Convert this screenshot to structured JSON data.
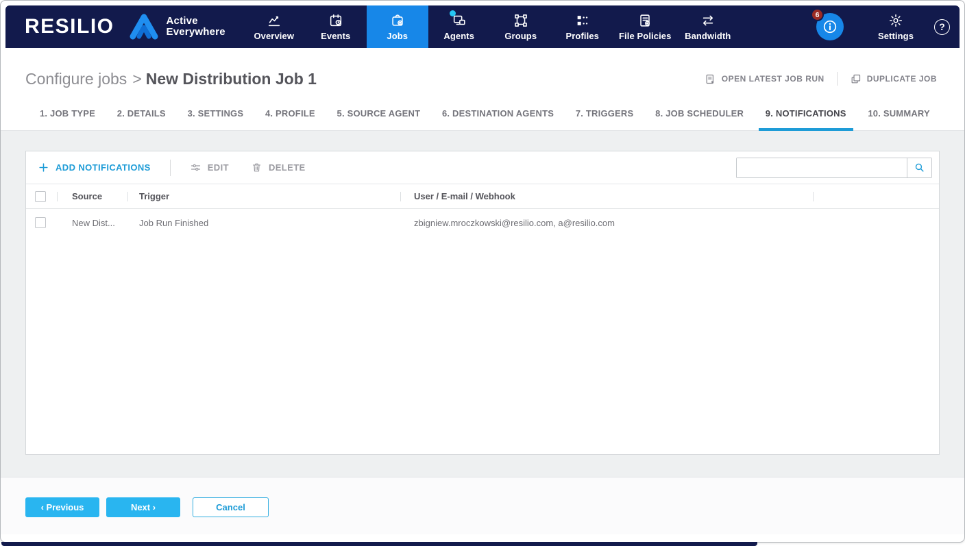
{
  "colors": {
    "navbar_bg": "#121a4c",
    "active_nav_blue": "#1787e8",
    "accent_blue": "#1e9cd7",
    "button_cyan": "#29b5f0",
    "badge_red": "#9c2b24",
    "agent_dot_cyan": "#25c7f4"
  },
  "navbar": {
    "brand": "RESILIO",
    "product_line1": "Active",
    "product_line2": "Everywhere",
    "items": [
      {
        "label": "Overview"
      },
      {
        "label": "Events"
      },
      {
        "label": "Jobs"
      },
      {
        "label": "Agents"
      },
      {
        "label": "Groups"
      },
      {
        "label": "Profiles"
      },
      {
        "label": "File Policies"
      },
      {
        "label": "Bandwidth"
      }
    ],
    "notification_badge": "6",
    "settings_label": "Settings",
    "help_label": "?"
  },
  "header": {
    "breadcrumb": "Configure jobs",
    "breadcrumb_sep": ">",
    "title": "New Distribution Job 1",
    "open_latest_label": "OPEN LATEST JOB RUN",
    "duplicate_label": "DUPLICATE JOB"
  },
  "tabs": [
    {
      "label": "1. JOB TYPE"
    },
    {
      "label": "2. DETAILS"
    },
    {
      "label": "3. SETTINGS"
    },
    {
      "label": "4. PROFILE"
    },
    {
      "label": "5. SOURCE AGENT"
    },
    {
      "label": "6. DESTINATION AGENTS"
    },
    {
      "label": "7. TRIGGERS"
    },
    {
      "label": "8. JOB SCHEDULER"
    },
    {
      "label": "9. NOTIFICATIONS"
    },
    {
      "label": "10. SUMMARY"
    }
  ],
  "toolbar": {
    "add_label": "ADD NOTIFICATIONS",
    "edit_label": "EDIT",
    "delete_label": "DELETE",
    "search_value": ""
  },
  "table": {
    "columns": [
      "Source",
      "Trigger",
      "User / E-mail / Webhook"
    ],
    "rows": [
      {
        "source": "New Dist...",
        "trigger": "Job Run Finished",
        "recipients": "zbigniew.mroczkowski@resilio.com, a@resilio.com"
      }
    ]
  },
  "footer": {
    "previous_label": "‹ Previous",
    "next_label": "Next ›",
    "cancel_label": "Cancel"
  }
}
